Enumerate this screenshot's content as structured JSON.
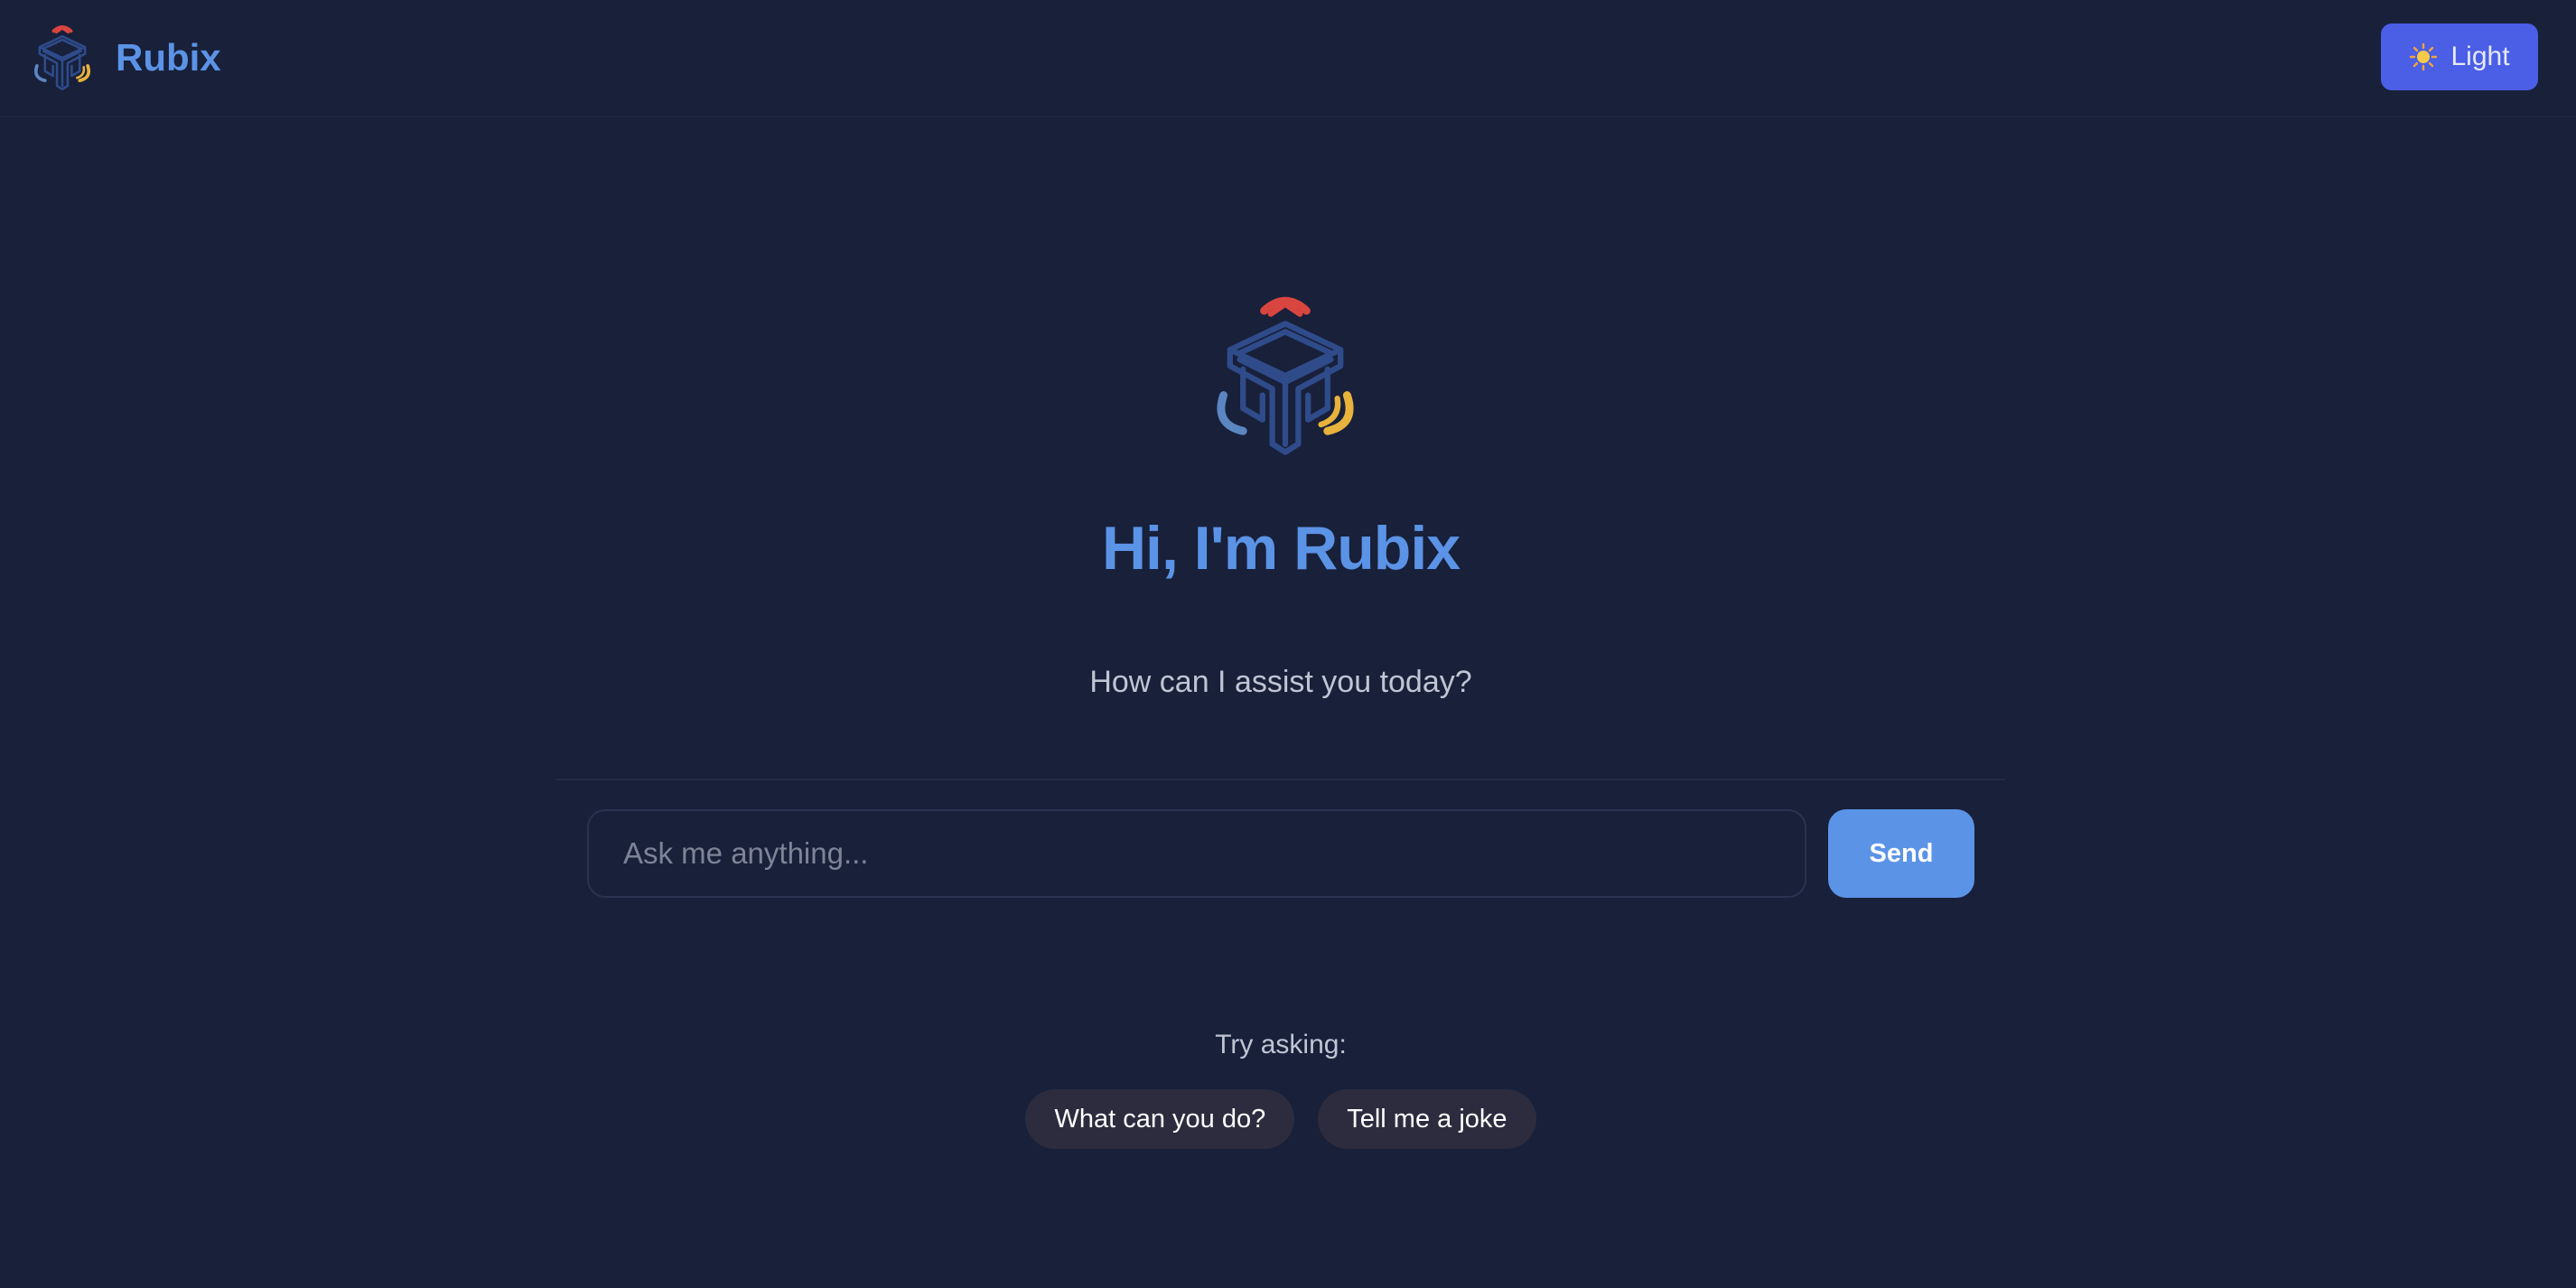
{
  "app": {
    "name": "Rubix",
    "logo_icon": "rubix-cube-logo-icon"
  },
  "header": {
    "theme_toggle": {
      "label": "Light",
      "icon": "sun-icon"
    }
  },
  "hero": {
    "title": "Hi, I'm Rubix",
    "subtitle": "How can I assist you today?"
  },
  "chat": {
    "input_placeholder": "Ask me anything...",
    "input_value": "",
    "send_label": "Send"
  },
  "suggestions": {
    "label": "Try asking:",
    "items": [
      {
        "label": "What can you do?"
      },
      {
        "label": "Tell me a joke"
      }
    ]
  },
  "colors": {
    "background": "#18203a",
    "accent": "#5b93e6",
    "theme_button": "#4a5ee6",
    "chip": "#2c2c3e",
    "logo_red": "#d9453f",
    "logo_blue": "#5b86c2",
    "logo_yellow": "#e8b33c",
    "logo_navy": "#2f4b8a"
  }
}
